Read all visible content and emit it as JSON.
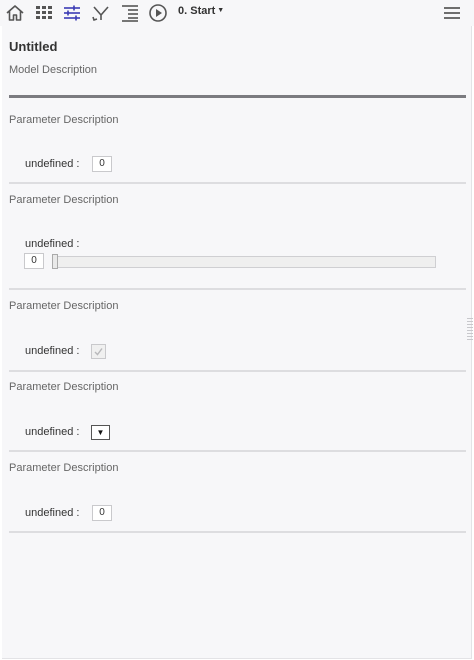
{
  "toolbar": {
    "icons": [
      "home-icon",
      "grid-icon",
      "sliders-icon",
      "branch-icon",
      "indent-list-icon",
      "play-circle-icon"
    ],
    "step_select": "0. Start",
    "menu_icon": "hamburger-menu-icon",
    "active_color": "#3a3ab5",
    "icon_color": "#555555"
  },
  "model": {
    "title": "Untitled",
    "description": "Model Description"
  },
  "parameters": [
    {
      "description": "Parameter Description",
      "label": "undefined :",
      "control": "number",
      "value": "0"
    },
    {
      "description": "Parameter Description",
      "label": "undefined :",
      "control": "slider",
      "value": "0"
    },
    {
      "description": "Parameter Description",
      "label": "undefined :",
      "control": "checkbox",
      "checked": true
    },
    {
      "description": "Parameter Description",
      "label": "undefined :",
      "control": "select",
      "value": ""
    },
    {
      "description": "Parameter Description",
      "label": "undefined :",
      "control": "number",
      "value": "0"
    }
  ]
}
